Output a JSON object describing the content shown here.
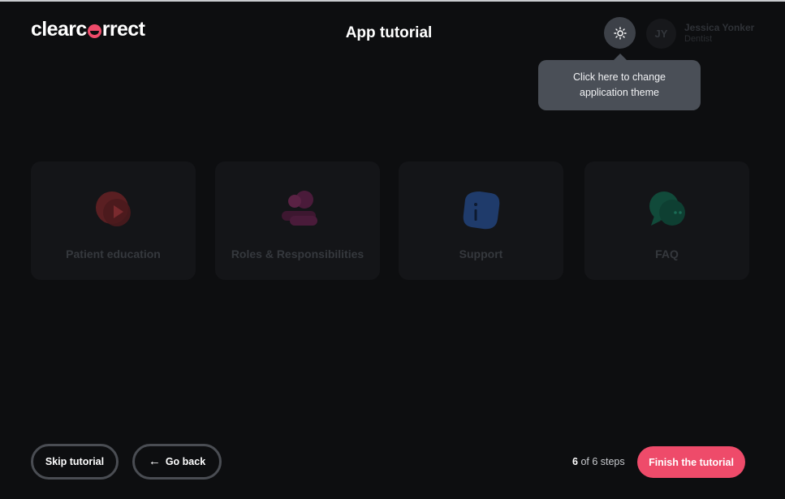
{
  "brand": {
    "logo_pre": "clearc",
    "logo_post": "rrect",
    "accent": "#ee4b6a"
  },
  "header": {
    "title": "App tutorial",
    "theme_icon": "sun-icon",
    "user": {
      "initials": "JY",
      "name": "Jessica Yonker",
      "role": "Dentist"
    }
  },
  "tooltip": {
    "text": "Click here to change application theme"
  },
  "cards": [
    {
      "label": "Patient education",
      "icon": "video-play-icon",
      "color": "#5a1f22"
    },
    {
      "label": "Roles & Responsibilities",
      "icon": "users-icon",
      "color": "#4a1b3a"
    },
    {
      "label": "Support",
      "icon": "info-icon",
      "color": "#1f3b6b"
    },
    {
      "label": "FAQ",
      "icon": "chat-bubbles-icon",
      "color": "#114a3a"
    }
  ],
  "footer": {
    "skip_label": "Skip tutorial",
    "back_label": "Go back",
    "steps_current": "6",
    "steps_text": "of 6 steps",
    "finish_label": "Finish the tutorial"
  }
}
